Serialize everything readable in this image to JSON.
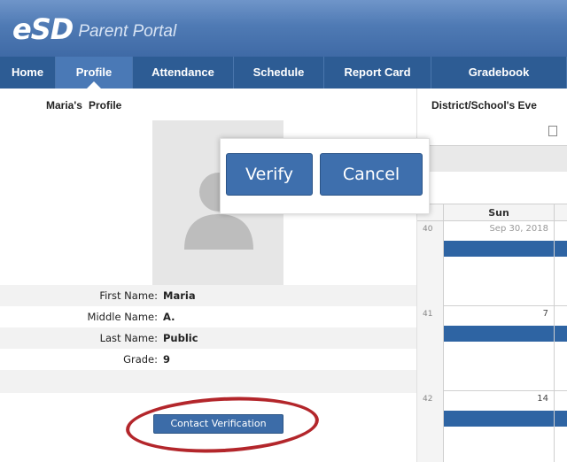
{
  "header": {
    "logo_text": "eSD",
    "portal_name": "Parent Portal"
  },
  "nav": {
    "items": [
      {
        "label": "Home"
      },
      {
        "label": "Profile"
      },
      {
        "label": "Attendance"
      },
      {
        "label": "Schedule"
      },
      {
        "label": "Report Card"
      },
      {
        "label": "Gradebook"
      }
    ],
    "active": "Profile"
  },
  "profile": {
    "owner": "Maria's",
    "title": "Profile",
    "avatar_icon": "user-silhouette-icon",
    "fields": [
      {
        "label": "First Name:",
        "value": "Maria"
      },
      {
        "label": "Middle Name:",
        "value": "A."
      },
      {
        "label": "Last Name:",
        "value": "Public"
      },
      {
        "label": "Grade:",
        "value": "9"
      }
    ],
    "contact_button": "Contact Verification"
  },
  "popup": {
    "verify_label": "Verify",
    "cancel_label": "Cancel"
  },
  "calendar": {
    "title": "District/School's Eve",
    "day_header": "Sun",
    "weeks": [
      {
        "week": "40",
        "date": "Sep 30, 2018"
      },
      {
        "week": "41",
        "date": "7"
      },
      {
        "week": "42",
        "date": "14"
      }
    ]
  },
  "colors": {
    "nav_bg": "#2d5c94",
    "nav_active": "#4a79b6",
    "button": "#3c6ca8",
    "event_bar": "#2e64a3",
    "highlight_ring": "#b3262b"
  }
}
